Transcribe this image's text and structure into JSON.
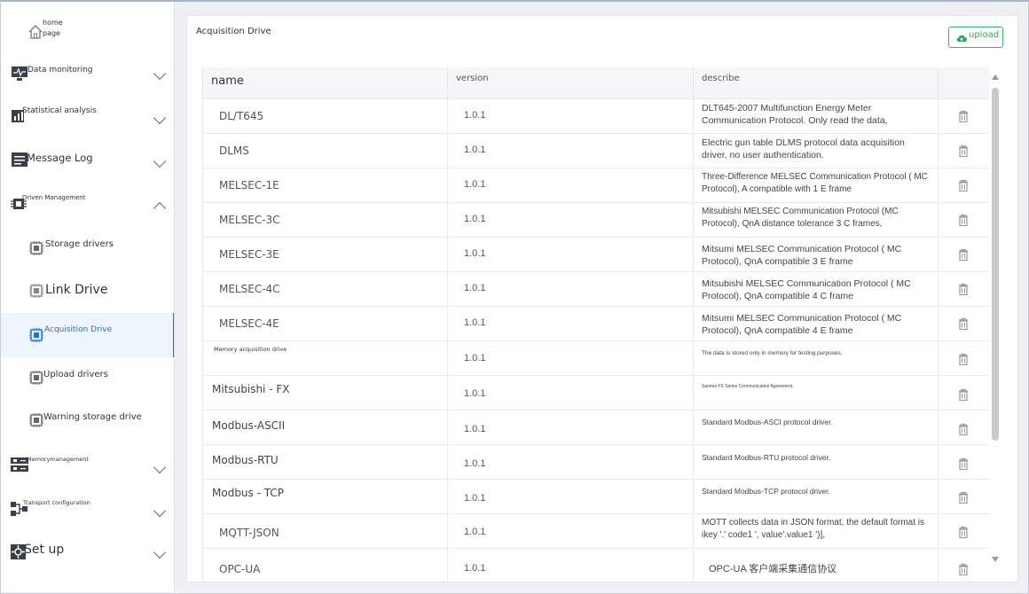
{
  "sidebar": {
    "items": [
      {
        "label": "home page",
        "line1": "home",
        "line2": "page",
        "icon": "home-icon"
      },
      {
        "label": "Data monitoring",
        "icon": "monitor-icon"
      },
      {
        "label": "Statistical analysis",
        "icon": "chart-icon"
      },
      {
        "label": "Message Log",
        "icon": "log-icon"
      },
      {
        "label": "Driven Management",
        "icon": "chip-icon",
        "expanded": true
      },
      {
        "label": "Storage drivers",
        "icon": "chip-icon"
      },
      {
        "label": "Link Drive",
        "icon": "chip-icon"
      },
      {
        "label": "Acquisition Drive",
        "icon": "chip-icon",
        "active": true
      },
      {
        "label": "Upload drivers",
        "icon": "chip-icon"
      },
      {
        "label": "Warning storage drive",
        "icon": "chip-icon"
      },
      {
        "label": "Memorymanagement",
        "icon": "memory-icon"
      },
      {
        "label": "Transport configuration",
        "icon": "transport-icon"
      },
      {
        "label": "Set up",
        "icon": "settings-icon"
      }
    ]
  },
  "main": {
    "title": "Acquisition Drive",
    "upload_label": "upload",
    "table": {
      "headers": {
        "name": "name",
        "version": "version",
        "describe": "describe"
      },
      "rows": [
        {
          "name": "DL/T645",
          "version": "1.0.1",
          "describe": "DLT645-2007 Multifunction Energy Meter Communication Protocol. Only read the data,"
        },
        {
          "name": "DLMS",
          "version": "1.0.1",
          "describe": "Electric gun table DLMS protocol data acquisition driver, no user authentication."
        },
        {
          "name": "MELSEC-1E",
          "version": "1.0.1",
          "describe": "Three-Difference MELSEC Communication Protocol ( MC Protocol), A compatible with 1 E frame"
        },
        {
          "name": "MELSEC-3C",
          "version": "1.0.1",
          "describe": "Mitsubishi MELSEC Communication Protocol (MC Protocol), QnA distance tolerance 3 C frames,"
        },
        {
          "name": "MELSEC-3E",
          "version": "1.0.1",
          "describe": "Mitsumi MELSEC Communication Protocol ( MC Protocol), QnA compatible 3 E frame"
        },
        {
          "name": "MELSEC-4C",
          "version": "1.0.1",
          "describe": "Mitsubishi MELSEC Communication Protocol ( MC Protocol), QnA compatible 4 C frame"
        },
        {
          "name": "MELSEC-4E",
          "version": "1.0.1",
          "describe": "Mitsumi MELSEC Communication Protocol ( MC Protocol), QnA compatible 4 E frame"
        },
        {
          "name": "Memory acquisition drive",
          "version": "1.0.1",
          "describe": "The data is stored only in memory for testing purposes."
        },
        {
          "name": "Mitsubishi - FX",
          "version": "1.0.1",
          "describe": "Sanmei FX Series Communication Agreement."
        },
        {
          "name": "Modbus-ASCII",
          "version": "1.0.1",
          "describe": "Standard Modbus-ASCI protocol driver."
        },
        {
          "name": "Modbus-RTU",
          "version": "1.0.1",
          "describe": "Standard Modbus-RTU protocol driver."
        },
        {
          "name": "Modbus - TCP",
          "version": "1.0.1",
          "describe": "Standard Modbus-TCP protocol driver."
        },
        {
          "name": "MQTT-JSON",
          "version": "1.0.1",
          "describe": "MOTT collects data in JSON format, the default format is ikey '.' code1 ', value'.value1 ')],"
        },
        {
          "name": "OPC-UA",
          "version": "1.0.1",
          "describe": "OPC-UA 客户端采集通信协议"
        }
      ]
    }
  },
  "colors": {
    "accent": "#1f72d6",
    "upload_green": "#2fa55d",
    "active_bg": "#eef5fd"
  }
}
